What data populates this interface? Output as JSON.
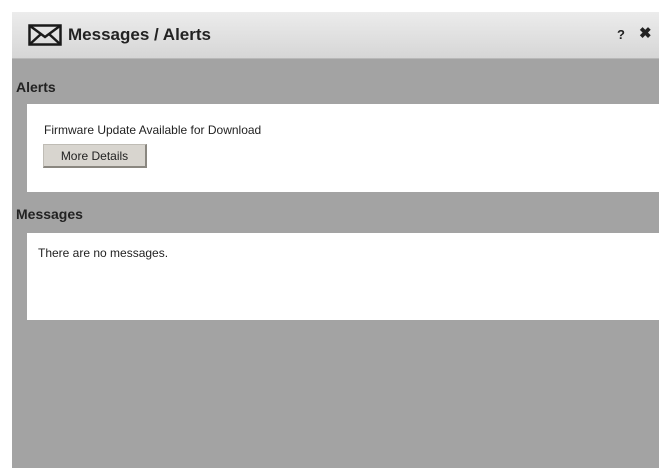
{
  "window": {
    "title": "Messages / Alerts",
    "help_label": "?",
    "close_label": "✖",
    "icon": "envelope-icon"
  },
  "alerts": {
    "heading": "Alerts",
    "items": [
      {
        "text": "Firmware Update Available for Download",
        "button_label": "More Details"
      }
    ]
  },
  "messages": {
    "heading": "Messages",
    "empty_text": "There are no messages."
  },
  "colors": {
    "background": "#a3a3a3",
    "panel": "#ffffff",
    "titlebar": "#e2e2e2",
    "button": "#d8d5cf"
  }
}
